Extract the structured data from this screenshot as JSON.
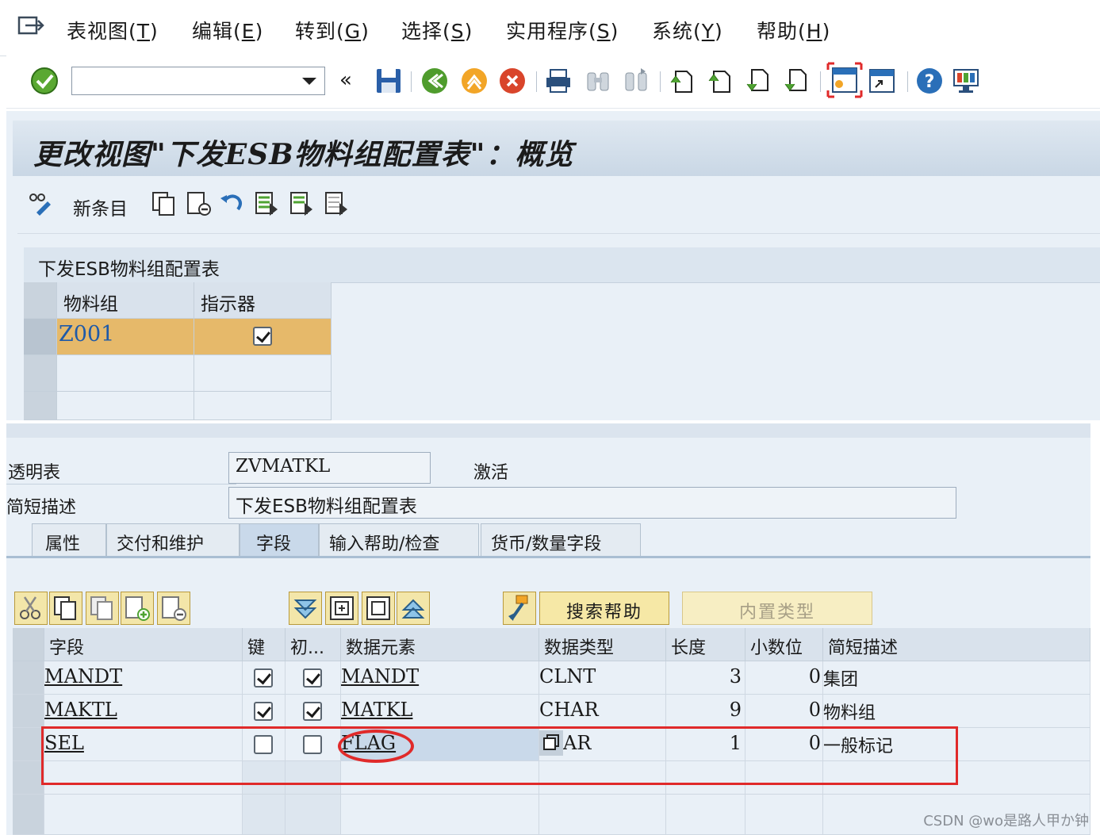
{
  "menu": {
    "items": [
      {
        "label": "表视图(",
        "key": "T",
        "tail": ")"
      },
      {
        "label": "编辑(",
        "key": "E",
        "tail": ")"
      },
      {
        "label": "转到(",
        "key": "G",
        "tail": ")"
      },
      {
        "label": "选择(",
        "key": "S",
        "tail": ")"
      },
      {
        "label": "实用程序(",
        "key": "S",
        "tail": ")"
      },
      {
        "label": "系统(",
        "key": "Y",
        "tail": ")"
      },
      {
        "label": "帮助(",
        "key": "H",
        "tail": ")"
      }
    ]
  },
  "toolbar": {
    "command_field": "",
    "icons": [
      "enter-icon",
      "back-double-icon",
      "save-icon",
      "back-icon",
      "exit-icon",
      "cancel-icon",
      "print-icon",
      "find-icon",
      "find-next-icon",
      "first-page-icon",
      "previous-page-icon",
      "next-page-icon",
      "last-page-icon",
      "create-session-icon",
      "shortcut-icon",
      "help-icon",
      "layout-icon"
    ]
  },
  "screen": {
    "title": "更改视图\"下发ESB物料组配置表\"：概览",
    "new_entry_label": "新条目",
    "table_title": "下发ESB物料组配置表",
    "columns": [
      "物料组",
      "指示器"
    ],
    "rows": [
      {
        "material_group": "Z001",
        "indicator": true
      },
      {
        "material_group": "",
        "indicator": null
      },
      {
        "material_group": "",
        "indicator": null
      }
    ]
  },
  "dict": {
    "transparent_table_label": "透明表",
    "transparent_table_value": "ZVMATKL",
    "status": "激活",
    "short_desc_label": "简短描述",
    "short_desc_value": "下发ESB物料组配置表",
    "tabs": [
      "属性",
      "交付和维护",
      "字段",
      "输入帮助/检查",
      "货币/数量字段"
    ],
    "active_tab": "字段",
    "search_help_button": "搜索帮助",
    "builtin_type_button": "内置类型",
    "field_columns": [
      "字段",
      "键",
      "初...",
      "数据元素",
      "数据类型",
      "长度",
      "小数位",
      "简短描述"
    ],
    "fields": [
      {
        "field": "MANDT",
        "key": true,
        "init": true,
        "data_element": "MANDT",
        "data_type": "CLNT",
        "length": "3",
        "decimals": "0",
        "desc": "集团"
      },
      {
        "field": "MAKTL",
        "key": true,
        "init": true,
        "data_element": "MATKL",
        "data_type": "CHAR",
        "length": "9",
        "decimals": "0",
        "desc": "物料组"
      },
      {
        "field": "SEL",
        "key": false,
        "init": false,
        "data_element": "FLAG",
        "data_type": "AR",
        "length": "1",
        "decimals": "0",
        "desc": "一般标记"
      }
    ]
  },
  "watermark": "CSDN @wo是路人甲か钟",
  "colors": {
    "highlight_row": "#e6b96a",
    "annotation_red": "#e02a2a",
    "panel_bg": "#e9f0f7"
  }
}
